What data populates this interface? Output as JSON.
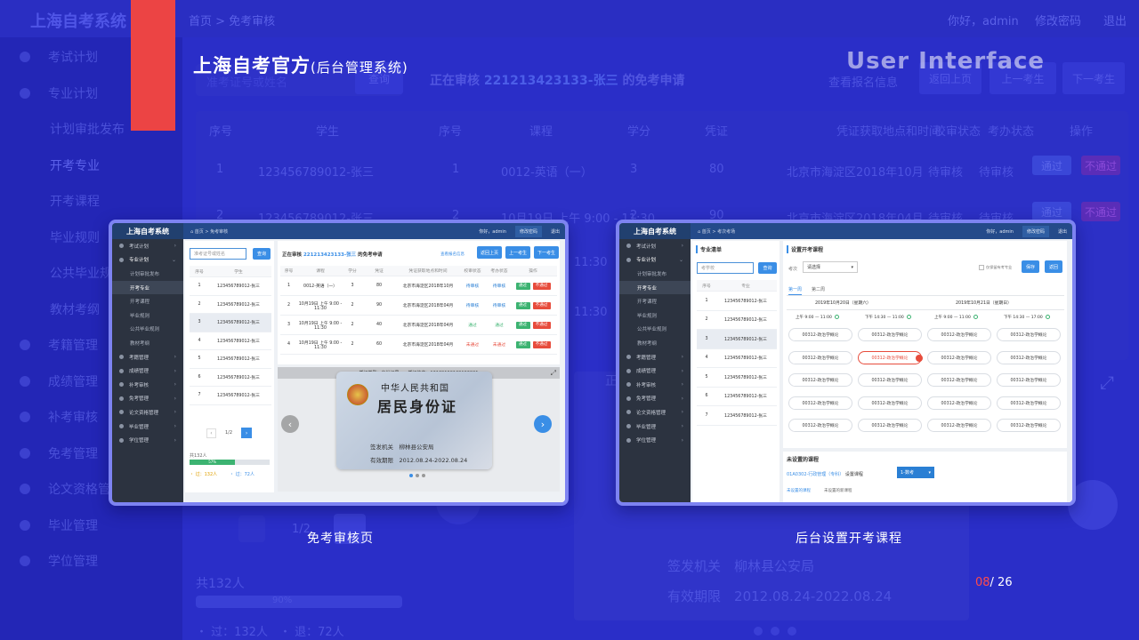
{
  "background": {
    "brand": "上海自考系统",
    "breadcrumb": "首页 > 免考审核",
    "top_right": [
      "你好，admin",
      "修改密码",
      "退出"
    ],
    "side_items": [
      "考试计划",
      "专业计划",
      "计划审批发布",
      "开考专业",
      "开考课程",
      "毕业规则",
      "公共毕业规则",
      "教材考纲",
      "考籍管理",
      "成绩管理",
      "补考审核",
      "免考管理",
      "论文资格管理",
      "毕业管理",
      "学位管理"
    ],
    "search_placeholder": "准考证号或姓名",
    "search_button": "查询",
    "reviewing": "正在审核",
    "reviewing_id": "221213423133-张三",
    "reviewing_suffix": "的免考申请",
    "view_info": "查看报名信息",
    "buttons": [
      "返回上页",
      "上一考生",
      "下一考生"
    ],
    "table_headers": [
      "序号",
      "学生",
      "序号",
      "课程",
      "学分",
      "凭证",
      "凭证获取地点和时间",
      "校审状态",
      "考办状态",
      "操作"
    ],
    "rows": [
      {
        "no": "1",
        "student": "123456789012-张三",
        "idx": "1",
        "course": "0012-英语（一）",
        "credit": "3",
        "voucher": "80",
        "place": "北京市海淀区2018年10月",
        "school": "待审核",
        "office": "待审核",
        "pass": "通过",
        "reject": "不通过"
      },
      {
        "no": "2",
        "student": "123456789012-张三",
        "idx": "2",
        "course": "10月19日 上午 9:00 - 11:30",
        "credit": "2",
        "voucher": "90",
        "place": "北京市海淀区2018年04月",
        "school": "待审核",
        "office": "待审核",
        "pass": "通过",
        "reject": "不通过"
      }
    ],
    "time_frag": "11:30",
    "total": "共132人",
    "progress": "90%",
    "stats": "・ 过：132人　・ 退：72人",
    "page": "1/2",
    "card_issuer_label": "签发机关",
    "card_issuer": "柳林县公安局",
    "card_valid_label": "有效期限",
    "card_valid": "2012.08.24-2022.08.24"
  },
  "header": {
    "title": "上海自考官方",
    "subtitle": "(后台管理系统)",
    "ui_word": "User Interface"
  },
  "shot1": {
    "brand": "上海自考系统",
    "breadcrumb": "首页 > 免考审核",
    "greeting": "你好，admin",
    "change_pwd": "修改密码",
    "logout": "退出",
    "nav": [
      {
        "label": "考试计划",
        "type": "top",
        "arrow": "›"
      },
      {
        "label": "专业计划",
        "type": "open",
        "arrow": "⌄"
      },
      {
        "label": "计划审批发布",
        "type": "sub"
      },
      {
        "label": "开考专业",
        "type": "sub-active"
      },
      {
        "label": "开考课程",
        "type": "sub"
      },
      {
        "label": "毕业规则",
        "type": "sub"
      },
      {
        "label": "公共毕业规则",
        "type": "sub"
      },
      {
        "label": "教材考纲",
        "type": "sub"
      },
      {
        "label": "考籍管理",
        "type": "top",
        "arrow": "›"
      },
      {
        "label": "成绩管理",
        "type": "top",
        "arrow": "›"
      },
      {
        "label": "补考审核",
        "type": "top",
        "arrow": "›"
      },
      {
        "label": "免考管理",
        "type": "top",
        "arrow": "›"
      },
      {
        "label": "论文资格管理",
        "type": "top",
        "arrow": "›"
      },
      {
        "label": "毕业管理",
        "type": "top",
        "arrow": "›"
      },
      {
        "label": "学位管理",
        "type": "top",
        "arrow": "›"
      }
    ],
    "search_placeholder": "准考证号或姓名",
    "search_button": "查询",
    "list_headers": [
      "序号",
      "学生"
    ],
    "list_rows": [
      [
        "1",
        "123456789012-张三"
      ],
      [
        "2",
        "123456789012-张三"
      ],
      [
        "3",
        "123456789012-张三"
      ],
      [
        "4",
        "123456789012-张三"
      ],
      [
        "5",
        "123456789012-张三"
      ],
      [
        "6",
        "123456789012-张三"
      ],
      [
        "7",
        "123456789012-张三"
      ]
    ],
    "pagination": {
      "prev": "‹",
      "page": "1/2",
      "next": "›"
    },
    "total": "共132人",
    "progress_label": "57%",
    "progress_value": 0.57,
    "stat_pass": "・ 过：132人",
    "stat_fail": "・ 过：72人",
    "reviewing": "正在审核",
    "reviewing_id": "221213423133-张三",
    "reviewing_suffix": "的免考申请",
    "view_info": "查看报名信息",
    "back": "返回上页",
    "prev_student": "上一考生",
    "next_student": "下一考生",
    "table_headers": [
      "序号",
      "课程",
      "学分",
      "凭证",
      "凭证获取地点和时间",
      "校审状态",
      "考办状态",
      "操作"
    ],
    "table_rows": [
      {
        "no": "1",
        "course": "0012-英语（一）",
        "credit": "3",
        "voucher": "80",
        "place": "北京市海淀区2018年10月",
        "school": "待审核",
        "office": "待审核",
        "school_color": "#2a7fd4",
        "office_color": "#2a7fd4",
        "pass": "通过",
        "reject": "不通过"
      },
      {
        "no": "2",
        "course": "10月19日 上午 9:00 - 11:30",
        "credit": "2",
        "voucher": "90",
        "place": "北京市海淀区2018年04月",
        "school": "待审核",
        "office": "待审核",
        "school_color": "#2a7fd4",
        "office_color": "#2a7fd4",
        "pass": "通过",
        "reject": "不通过"
      },
      {
        "no": "3",
        "course": "10月19日 上午 9:00 - 11:30",
        "credit": "2",
        "voucher": "40",
        "place": "北京市海淀区2018年04月",
        "school": "通过",
        "office": "通过",
        "school_color": "#3cb371",
        "office_color": "#3cb371",
        "pass": "通过",
        "reject": "不通过"
      },
      {
        "no": "4",
        "course": "10月19日 上午 9:00 - 11:30",
        "credit": "2",
        "voucher": "60",
        "place": "北京市海淀区2018年04月",
        "school": "未通过",
        "office": "未通过",
        "school_color": "#e74c3c",
        "office_color": "#e74c3c",
        "pass": "通过",
        "reject": "不通过"
      }
    ],
    "id_bar": "凭证类型：身份证号　　凭证信息：12129199129192921",
    "id_title1": "中华人民共和国",
    "id_title2": "居民身份证",
    "id_issuer_label": "签发机关",
    "id_issuer": "柳林县公安局",
    "id_valid_label": "有效期限",
    "id_valid": "2012.08.24-2022.08.24",
    "caption": "免考审核页"
  },
  "shot2": {
    "brand": "上海自考系统",
    "breadcrumb": "首页 > 考次考场",
    "greeting": "你好，admin",
    "change_pwd": "修改密码",
    "logout": "退出",
    "nav": [
      {
        "label": "考试计划",
        "type": "top",
        "arrow": "›"
      },
      {
        "label": "专业计划",
        "type": "open",
        "arrow": "⌄"
      },
      {
        "label": "计划审批发布",
        "type": "sub"
      },
      {
        "label": "开考专业",
        "type": "sub-active"
      },
      {
        "label": "开考课程",
        "type": "sub"
      },
      {
        "label": "毕业规则",
        "type": "sub"
      },
      {
        "label": "公共毕业规则",
        "type": "sub"
      },
      {
        "label": "教材考纲",
        "type": "sub"
      },
      {
        "label": "考籍管理",
        "type": "top",
        "arrow": "›"
      },
      {
        "label": "成绩管理",
        "type": "top",
        "arrow": "›"
      },
      {
        "label": "补考审核",
        "type": "top",
        "arrow": "›"
      },
      {
        "label": "免考管理",
        "type": "top",
        "arrow": "›"
      },
      {
        "label": "论文资格管理",
        "type": "top",
        "arrow": "›"
      },
      {
        "label": "毕业管理",
        "type": "top",
        "arrow": "›"
      },
      {
        "label": "学位管理",
        "type": "top",
        "arrow": "›"
      }
    ],
    "list_title": "专业清单",
    "search_placeholder": "考学校",
    "search_button": "查询",
    "list_headers": [
      "序号",
      "专业"
    ],
    "list_rows": [
      [
        "1",
        "123456789012-张三"
      ],
      [
        "2",
        "123456789012-张三"
      ],
      [
        "3",
        "123456789012-张三"
      ],
      [
        "4",
        "123456789012-张三"
      ],
      [
        "5",
        "123456789012-张三"
      ],
      [
        "6",
        "123456789012-张三"
      ],
      [
        "7",
        "123456789012-张三"
      ]
    ],
    "set_title": "设置开考课程",
    "exam_label": "考次",
    "exam_select": "请选择",
    "checkbox_label": "仅保留有考专业",
    "save": "保存",
    "back": "返回",
    "tabs": [
      "第一周",
      "第二周"
    ],
    "days": [
      "2019年10月20日（星期六）",
      "2019年10月21日（星期日）"
    ],
    "slots": [
      "上午 9:00 — 11:00",
      "下午 14:30 — 11:00",
      "上午 9:00 — 11:00",
      "下午 14:30 — 17:00"
    ],
    "course_name": "00312-政治学概论",
    "unset_title": "未设置的课程",
    "unset_course": "01A0302-行政管理（专科）",
    "unset_action": "设置课程",
    "unset_select": "1-数考",
    "unset_tabs": [
      "未设置的课程",
      "未设置的新课程"
    ],
    "caption": "后台设置开考课程"
  },
  "pager": {
    "current": "08",
    "total": "/ 26"
  },
  "colors": {
    "background": "#2b2fc9",
    "accent_red": "#ec4444",
    "frame": "#7d83f2",
    "button_blue": "#3a8ee6",
    "pass_green": "#3cb371",
    "reject_red": "#e74c3c"
  }
}
